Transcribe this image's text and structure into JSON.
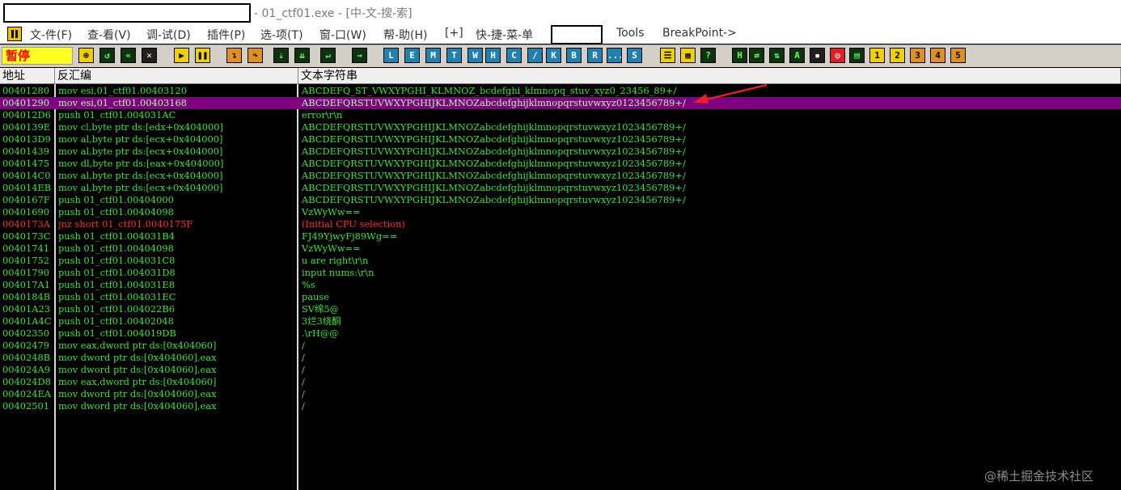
{
  "window": {
    "title": "- 01_ctf01.exe - [中-文-搜-索]"
  },
  "menu": {
    "items": [
      "文-件(F)",
      "查-看(V)",
      "调-试(D)",
      "插件(P)",
      "选-项(T)",
      "窗-口(W)",
      "帮-助(H)",
      "[+]",
      "快-捷-菜-单",
      "Tools",
      "BreakPoint->"
    ]
  },
  "toolbar": {
    "status": "暂停",
    "buttons": [
      "L",
      "E",
      "M",
      "T",
      "W",
      "H",
      "C",
      "/",
      "K",
      "B",
      "R",
      "...",
      "S",
      "H",
      "1",
      "2",
      "3",
      "4",
      "5"
    ]
  },
  "columns": {
    "address": "地址",
    "disasm": "反汇编",
    "string": "文本字符串"
  },
  "rows": [
    {
      "addr": "00401280",
      "disasm": "mov esi,01_ctf01.00403120",
      "str": "ABCDEFQ_ST_VWXYPGHI_KLMNOZ_bcdefghi_klmnopq_stuv_xyz0_23456_89+/"
    },
    {
      "addr": "00401290",
      "disasm": "mov esi,01_ctf01.00403168",
      "str": "ABCDEFQRSTUVWXYPGHIJKLMNOZabcdefghijklmnopqrstuvwxyz0123456789+/"
    },
    {
      "addr": "004012D6",
      "disasm": "push 01_ctf01.004031AC",
      "str": "error\\r\\n"
    },
    {
      "addr": "0040139E",
      "disasm": "mov cl,byte ptr ds:[edx+0x404000]",
      "str": "ABCDEFQRSTUVWXYPGHIJKLMNOZabcdefghijklmnopqrstuvwxyz1023456789+/"
    },
    {
      "addr": "004013D9",
      "disasm": "mov al,byte ptr ds:[ecx+0x404000]",
      "str": "ABCDEFQRSTUVWXYPGHIJKLMNOZabcdefghijklmnopqrstuvwxyz1023456789+/"
    },
    {
      "addr": "00401439",
      "disasm": "mov al,byte ptr ds:[ecx+0x404000]",
      "str": "ABCDEFQRSTUVWXYPGHIJKLMNOZabcdefghijklmnopqrstuvwxyz1023456789+/"
    },
    {
      "addr": "00401475",
      "disasm": "mov dl,byte ptr ds:[eax+0x404000]",
      "str": "ABCDEFQRSTUVWXYPGHIJKLMNOZabcdefghijklmnopqrstuvwxyz1023456789+/"
    },
    {
      "addr": "004014C0",
      "disasm": "mov al,byte ptr ds:[ecx+0x404000]",
      "str": "ABCDEFQRSTUVWXYPGHIJKLMNOZabcdefghijklmnopqrstuvwxyz1023456789+/"
    },
    {
      "addr": "004014EB",
      "disasm": "mov al,byte ptr ds:[ecx+0x404000]",
      "str": "ABCDEFQRSTUVWXYPGHIJKLMNOZabcdefghijklmnopqrstuvwxyz1023456789+/"
    },
    {
      "addr": "0040167F",
      "disasm": "push 01_ctf01.00404000",
      "str": "ABCDEFQRSTUVWXYPGHIJKLMNOZabcdefghijklmnopqrstuvwxyz1023456789+/"
    },
    {
      "addr": "00401690",
      "disasm": "push 01_ctf01.00404098",
      "str": "VzWyWw=="
    },
    {
      "addr": "0040173A",
      "disasm": "jnz short 01_ctf01.0040175F",
      "str": "(Initial CPU selection)"
    },
    {
      "addr": "0040173C",
      "disasm": "push 01_ctf01.004031B4",
      "str": "FJ49YjwyFj89Wg=="
    },
    {
      "addr": "00401741",
      "disasm": "push 01_ctf01.00404098",
      "str": "VzWyWw=="
    },
    {
      "addr": "00401752",
      "disasm": "push 01_ctf01.004031C8",
      "str": "u are right\\r\\n"
    },
    {
      "addr": "00401790",
      "disasm": "push 01_ctf01.004031D8",
      "str": "input nums:\\r\\n"
    },
    {
      "addr": "004017A1",
      "disasm": "push 01_ctf01.004031E8",
      "str": "%s"
    },
    {
      "addr": "0040184B",
      "disasm": "push 01_ctf01.004031EC",
      "str": "pause"
    },
    {
      "addr": "00401A23",
      "disasm": "push 01_ctf01.004022B6",
      "str": "SV绵5@"
    },
    {
      "addr": "00401A4C",
      "disasm": "push 01_ctf01.00402048",
      "str": "3烂3绕酮"
    },
    {
      "addr": "00402350",
      "disasm": "push 01_ctf01.004019DB",
      "str": ".\\rH@@"
    },
    {
      "addr": "00402479",
      "disasm": "mov eax,dword ptr ds:[0x404060]",
      "str": "/"
    },
    {
      "addr": "0040248B",
      "disasm": "mov dword ptr ds:[0x404060],eax",
      "str": "/"
    },
    {
      "addr": "004024A9",
      "disasm": "mov dword ptr ds:[0x404060],eax",
      "str": "/"
    },
    {
      "addr": "004024D8",
      "disasm": "mov eax,dword ptr ds:[0x404060]",
      "str": "/"
    },
    {
      "addr": "004024EA",
      "disasm": "mov dword ptr ds:[0x404060],eax",
      "str": "/"
    },
    {
      "addr": "00402501",
      "disasm": "mov dword ptr ds:[0x404060],eax",
      "str": "/"
    }
  ],
  "selected_row": 1,
  "breakpoint_row": 11,
  "colors": {
    "row_text": "#40e040",
    "selection": "#800080",
    "breakpoint_text": "#ff3030",
    "annotation_arrow": "#e8202a"
  },
  "watermark": "@稀土掘金技术社区"
}
